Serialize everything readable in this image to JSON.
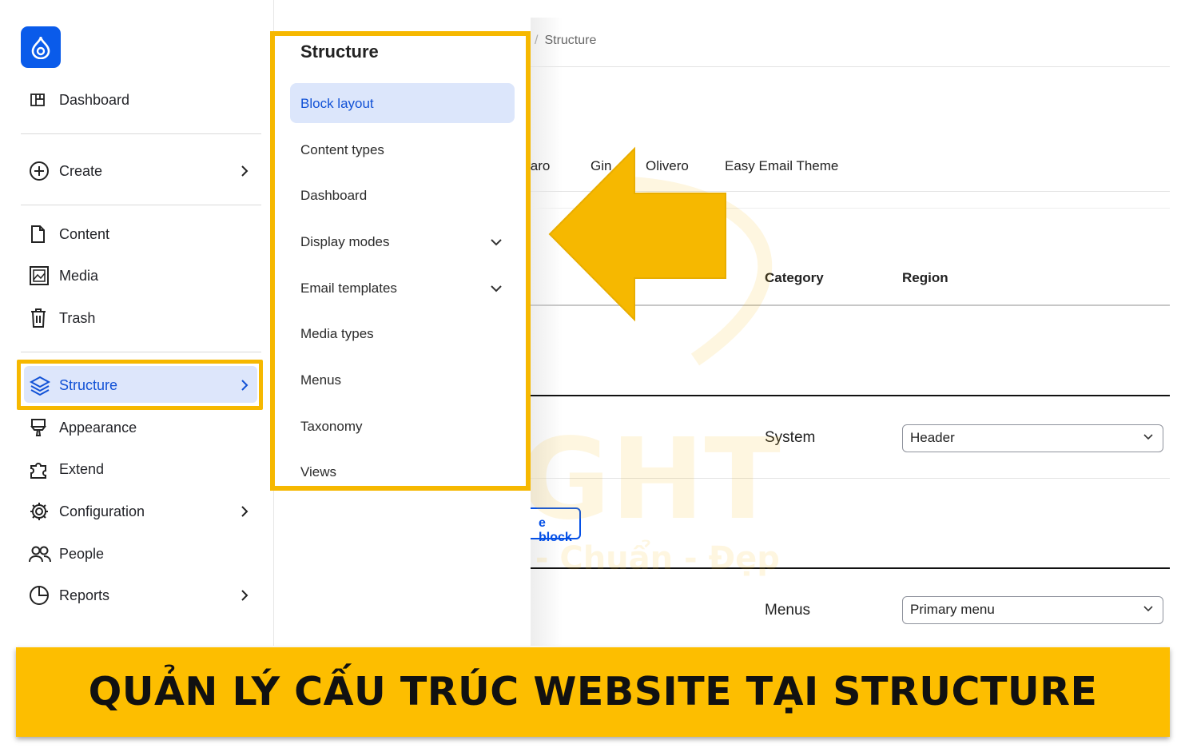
{
  "sidebar": {
    "logo": "drupal-logo",
    "items": [
      {
        "label": "Dashboard",
        "icon": "dashboard-icon"
      },
      {
        "label": "Create",
        "icon": "plus-circle-icon",
        "has_submenu": true
      },
      {
        "label": "Content",
        "icon": "file-icon"
      },
      {
        "label": "Media",
        "icon": "image-icon"
      },
      {
        "label": "Trash",
        "icon": "trash-icon"
      },
      {
        "label": "Structure",
        "icon": "layers-icon",
        "has_submenu": true,
        "active": true
      },
      {
        "label": "Appearance",
        "icon": "brush-icon"
      },
      {
        "label": "Extend",
        "icon": "puzzle-icon"
      },
      {
        "label": "Configuration",
        "icon": "gear-icon",
        "has_submenu": true
      },
      {
        "label": "People",
        "icon": "people-icon"
      },
      {
        "label": "Reports",
        "icon": "chart-icon",
        "has_submenu": true
      }
    ]
  },
  "flyout": {
    "title": "Structure",
    "items": [
      {
        "label": "Block layout",
        "active": true
      },
      {
        "label": "Content types"
      },
      {
        "label": "Dashboard"
      },
      {
        "label": "Display modes",
        "expandable": true
      },
      {
        "label": "Email templates",
        "expandable": true
      },
      {
        "label": "Media types"
      },
      {
        "label": "Menus"
      },
      {
        "label": "Taxonomy"
      },
      {
        "label": "Views"
      }
    ]
  },
  "main": {
    "breadcrumb_sep": "/",
    "breadcrumb": "Structure",
    "theme_tabs": [
      "laro",
      "Gin",
      "Olivero",
      "Easy Email Theme"
    ],
    "table_headers": {
      "category": "Category",
      "region": "Region"
    },
    "place_block_label": "e block",
    "rows": [
      {
        "category": "System",
        "region": "Header"
      },
      {
        "category": "Menus",
        "region": "Primary menu"
      }
    ]
  },
  "watermark": {
    "brand": "LIGHT",
    "tagline": "Nhanh - Chuẩn - Đẹp"
  },
  "banner": {
    "text": "QUẢN LÝ CẤU TRÚC WEBSITE TẠI STRUCTURE"
  },
  "colors": {
    "accent_yellow": "#f6b800",
    "banner_yellow": "#fdbe00",
    "drupal_blue": "#0a5bea",
    "active_bg": "#dce6fb",
    "link_blue": "#1151d6"
  }
}
